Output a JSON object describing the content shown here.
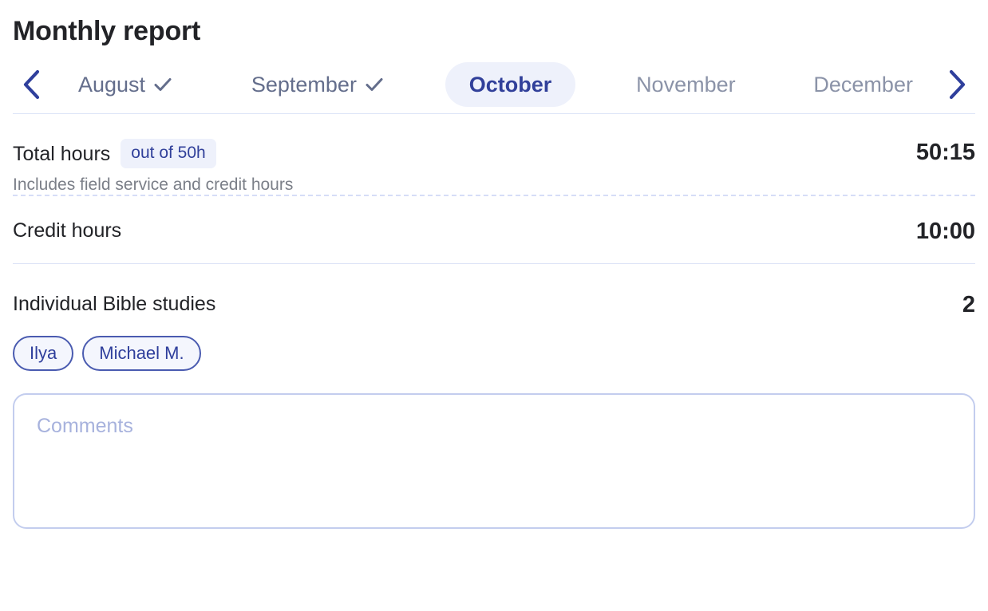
{
  "page": {
    "title": "Monthly report"
  },
  "month_nav": {
    "prev_icon": "chevron-left-icon",
    "next_icon": "chevron-right-icon",
    "check_icon": "check-icon",
    "active_month": "October",
    "months": [
      {
        "label": "August",
        "state": "past",
        "completed": true
      },
      {
        "label": "September",
        "state": "past",
        "completed": true
      },
      {
        "label": "October",
        "state": "active",
        "completed": false
      },
      {
        "label": "November",
        "state": "future",
        "completed": false
      },
      {
        "label": "December",
        "state": "future",
        "completed": false
      }
    ]
  },
  "total_hours": {
    "label": "Total hours",
    "badge": "out of 50h",
    "subtitle": "Includes field service and credit hours",
    "value": "50:15"
  },
  "credit_hours": {
    "label": "Credit hours",
    "value": "10:00"
  },
  "bible_studies": {
    "label": "Individual Bible studies",
    "value": "2",
    "students": [
      {
        "name": "Ilya"
      },
      {
        "name": "Michael M."
      }
    ]
  },
  "comments": {
    "placeholder": "Comments",
    "value": ""
  },
  "colors": {
    "accent": "#31409a",
    "accent_soft_bg": "#eef1fb",
    "chip_border": "#4a5bb0",
    "divider": "#dde4f7",
    "divider_dashed": "#d6ddf7",
    "muted_text": "#7b7f88",
    "month_inactive": "#8b93a8",
    "input_border": "#c3cdee",
    "placeholder": "#a7b2dd"
  }
}
